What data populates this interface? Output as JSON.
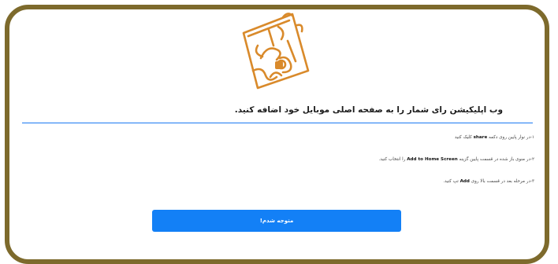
{
  "dialog": {
    "title": "وب اپلیکیشن رای شمار را به صفحه اصلی موبایل خود اضافه کنید.",
    "steps": [
      {
        "prefix": "۱-در نوار پایین روی دکمه ",
        "keyword": "share",
        "suffix": " کلیک کنید"
      },
      {
        "prefix": "۲-در منوی باز شده در قسمت پایین گزینه ",
        "keyword": "Add to Home Screen",
        "suffix": " را انتخاب کنید."
      },
      {
        "prefix": "۳-در مرحله بعد در قسمت بالا روی ",
        "keyword": "Add",
        "suffix": " تپ کنید."
      }
    ],
    "confirm_label": "متوجه شدم!"
  },
  "colors": {
    "frame": "#7d6a2c",
    "accent": "#1380f6",
    "logo": "#d98a2b"
  },
  "logo": {
    "icon": "calligraphy-logo-icon"
  }
}
